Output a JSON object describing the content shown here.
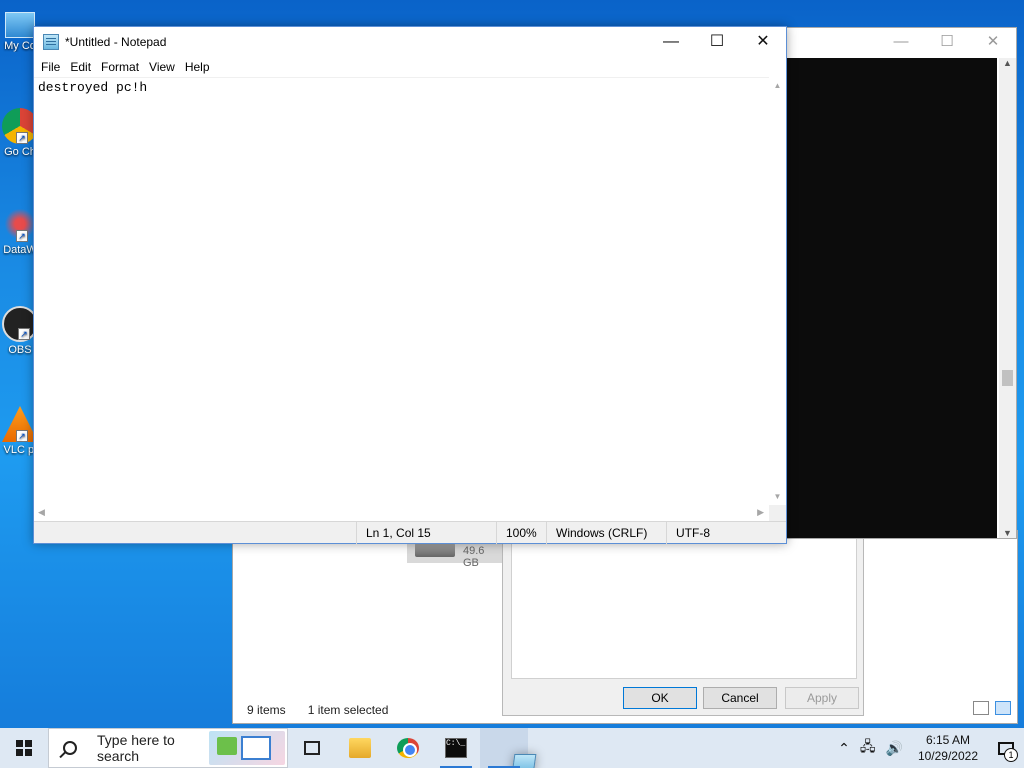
{
  "desktop": {
    "icons": [
      {
        "label": "My Co",
        "icon": "computer-icon"
      },
      {
        "label": "Go Ch",
        "icon": "chrome-icon"
      },
      {
        "label": "DataW",
        "icon": "datawrapper-icon"
      },
      {
        "label": "OBS",
        "icon": "obs-icon"
      },
      {
        "label": "VLC pl",
        "icon": "vlc-icon"
      }
    ]
  },
  "explorer": {
    "status_items": "9 items",
    "status_selected": "1 item selected",
    "drive_size": "49.6 GB"
  },
  "properties_dialog": {
    "ok": "OK",
    "cancel": "Cancel",
    "apply": "Apply"
  },
  "notepad": {
    "title": "*Untitled - Notepad",
    "menu": [
      "File",
      "Edit",
      "Format",
      "View",
      "Help"
    ],
    "content": "destroyed pc!h",
    "status": {
      "position": "Ln 1, Col 15",
      "zoom": "100%",
      "line_endings": "Windows (CRLF)",
      "encoding": "UTF-8"
    }
  },
  "taskbar": {
    "search_placeholder": "Type here to search",
    "apps": [
      "task-view",
      "file-explorer",
      "chrome",
      "command-prompt",
      "notepad"
    ],
    "time": "6:15 AM",
    "date": "10/29/2022",
    "notification_count": "1"
  },
  "colors": {
    "desktop_blue": "#1a8be4",
    "taskbar_bg": "#dee8f3",
    "accent": "#0078d7"
  }
}
